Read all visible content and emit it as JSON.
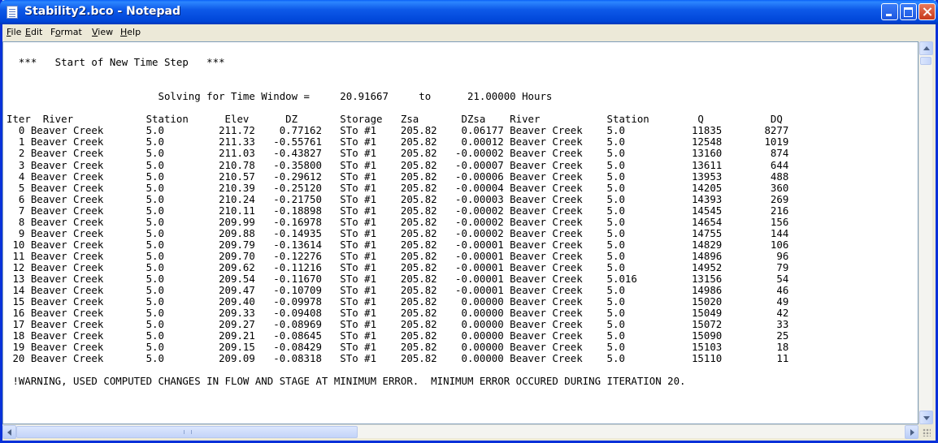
{
  "window": {
    "title": "Stability2.bco - Notepad"
  },
  "menu": [
    {
      "acc": "F",
      "rest": "ile"
    },
    {
      "acc": "E",
      "rest": "dit"
    },
    {
      "pre": "F",
      "acc": "o",
      "rest": "rmat"
    },
    {
      "acc": "V",
      "rest": "iew"
    },
    {
      "acc": "H",
      "rest": "elp"
    }
  ],
  "document": {
    "lines": [
      "",
      "  ***   Start of New Time Step   ***",
      "",
      "",
      "                         Solving for Time Window =     20.91667     to      21.00000 Hours",
      "",
      "Iter  River            Station      Elev      DZ       Storage   Zsa       DZsa    River           Station        Q           DQ",
      "  0 Beaver Creek       5.0         211.72    0.77162   STo #1    205.82    0.06177 Beaver Creek    5.0           11835       8277",
      "  1 Beaver Creek       5.0         211.33   -0.55761   STo #1    205.82    0.00012 Beaver Creek    5.0           12548       1019",
      "  2 Beaver Creek       5.0         211.03   -0.43827   STo #1    205.82   -0.00002 Beaver Creek    5.0           13160        874",
      "  3 Beaver Creek       5.0         210.78   -0.35800   STo #1    205.82   -0.00007 Beaver Creek    5.0           13611        644",
      "  4 Beaver Creek       5.0         210.57   -0.29612   STo #1    205.82   -0.00006 Beaver Creek    5.0           13953        488",
      "  5 Beaver Creek       5.0         210.39   -0.25120   STo #1    205.82   -0.00004 Beaver Creek    5.0           14205        360",
      "  6 Beaver Creek       5.0         210.24   -0.21750   STo #1    205.82   -0.00003 Beaver Creek    5.0           14393        269",
      "  7 Beaver Creek       5.0         210.11   -0.18898   STo #1    205.82   -0.00002 Beaver Creek    5.0           14545        216",
      "  8 Beaver Creek       5.0         209.99   -0.16978   STo #1    205.82   -0.00002 Beaver Creek    5.0           14654        156",
      "  9 Beaver Creek       5.0         209.88   -0.14935   STo #1    205.82   -0.00002 Beaver Creek    5.0           14755        144",
      " 10 Beaver Creek       5.0         209.79   -0.13614   STo #1    205.82   -0.00001 Beaver Creek    5.0           14829        106",
      " 11 Beaver Creek       5.0         209.70   -0.12276   STo #1    205.82   -0.00001 Beaver Creek    5.0           14896         96",
      " 12 Beaver Creek       5.0         209.62   -0.11216   STo #1    205.82   -0.00001 Beaver Creek    5.0           14952         79",
      " 13 Beaver Creek       5.0         209.54   -0.11670   STo #1    205.82   -0.00001 Beaver Creek    5.016         13156         54",
      " 14 Beaver Creek       5.0         209.47   -0.10709   STo #1    205.82   -0.00001 Beaver Creek    5.0           14986         46",
      " 15 Beaver Creek       5.0         209.40   -0.09978   STo #1    205.82    0.00000 Beaver Creek    5.0           15020         49",
      " 16 Beaver Creek       5.0         209.33   -0.09408   STo #1    205.82    0.00000 Beaver Creek    5.0           15049         42",
      " 17 Beaver Creek       5.0         209.27   -0.08969   STo #1    205.82    0.00000 Beaver Creek    5.0           15072         33",
      " 18 Beaver Creek       5.0         209.21   -0.08645   STo #1    205.82    0.00000 Beaver Creek    5.0           15090         25",
      " 19 Beaver Creek       5.0         209.15   -0.08429   STo #1    205.82    0.00000 Beaver Creek    5.0           15103         18",
      " 20 Beaver Creek       5.0         209.09   -0.08318   STo #1    205.82    0.00000 Beaver Creek    5.0           15110         11",
      "",
      " !WARNING, USED COMPUTED CHANGES IN FLOW AND STAGE AT MINIMUM ERROR.  MINIMUM ERROR OCCURED DURING ITERATION 20."
    ]
  },
  "colors": {
    "titlebar": "#0054e3",
    "window_bg": "#ece9d8",
    "text_bg": "#ffffff"
  }
}
